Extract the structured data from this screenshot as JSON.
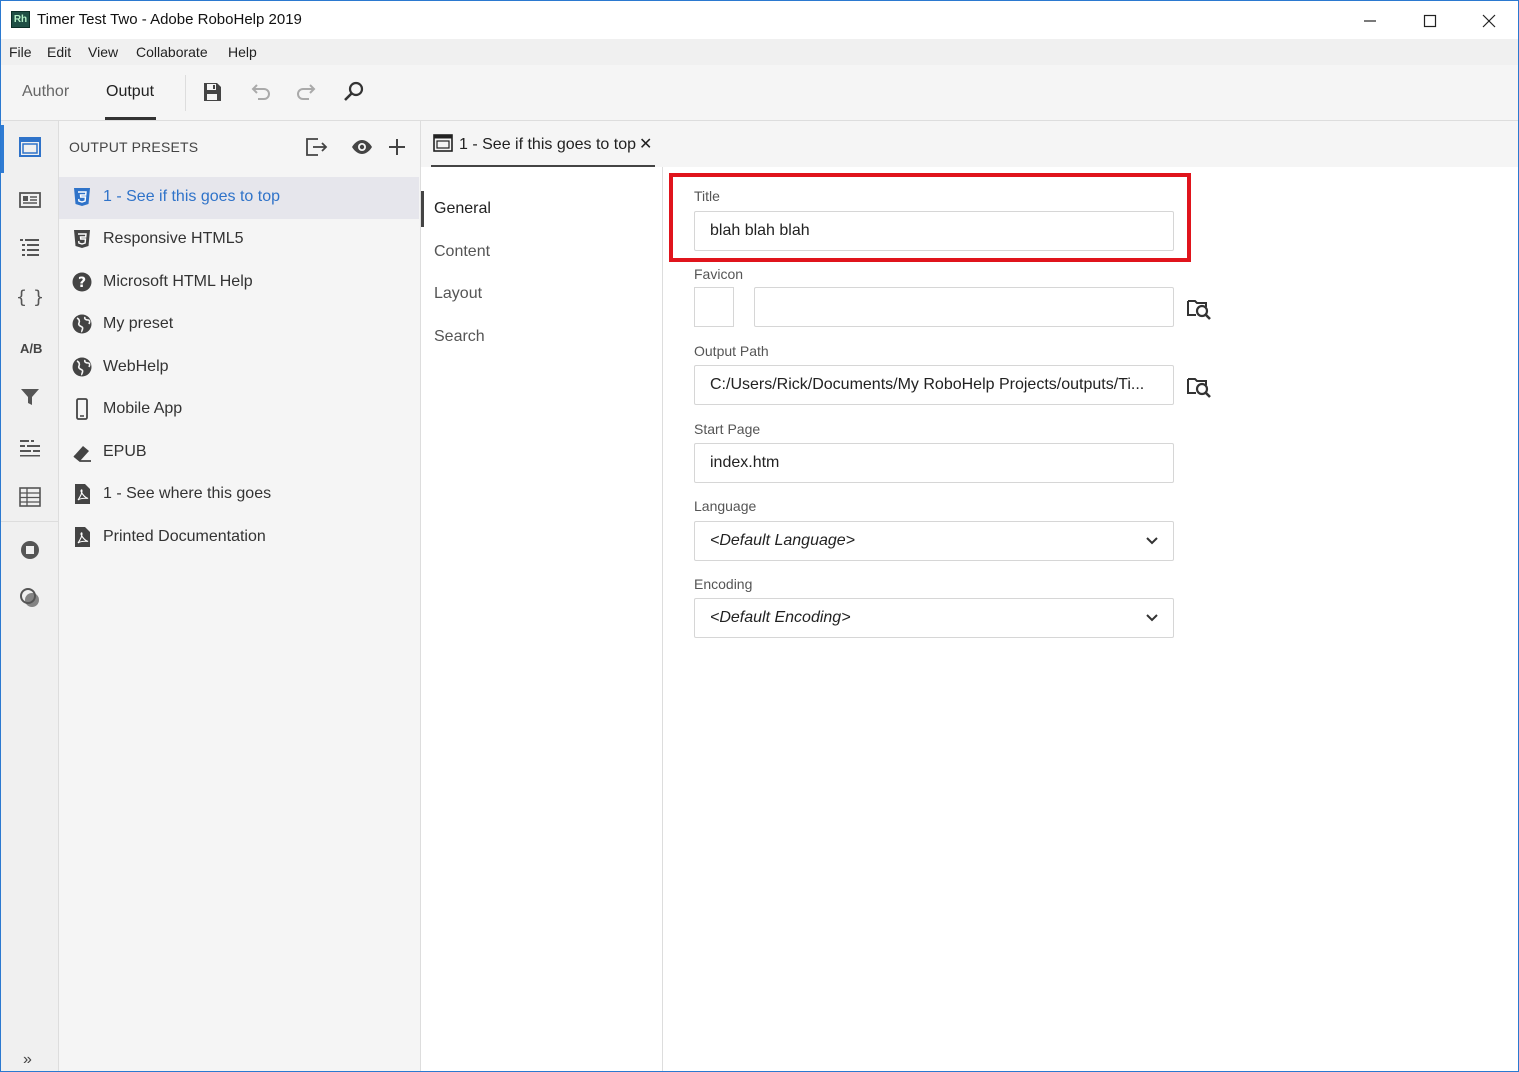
{
  "window": {
    "title": "Timer Test Two - Adobe RoboHelp 2019",
    "logo_text": "Rh",
    "minimize": "—",
    "maximize": "☐",
    "close": "✕"
  },
  "menu": [
    "File",
    "Edit",
    "View",
    "Collaborate",
    "Help"
  ],
  "toolbar": {
    "modes": [
      "Author",
      "Output"
    ],
    "active_mode": "Output",
    "icons": [
      "save-icon",
      "undo-icon",
      "redo-icon",
      "search-icon"
    ]
  },
  "rail": {
    "ab_label": "A/B",
    "expand_label": "»"
  },
  "presets_panel": {
    "header": "OUTPUT PRESETS",
    "items": [
      {
        "label": "1 - See if this goes to top",
        "icon": "html5-icon",
        "selected": true
      },
      {
        "label": "Responsive HTML5",
        "icon": "html5-icon"
      },
      {
        "label": "Microsoft HTML Help",
        "icon": "help-icon"
      },
      {
        "label": "My preset",
        "icon": "globe-icon"
      },
      {
        "label": "WebHelp",
        "icon": "globe-icon"
      },
      {
        "label": "Mobile App",
        "icon": "mobile-icon"
      },
      {
        "label": "EPUB",
        "icon": "epub-icon"
      },
      {
        "label": "1 - See where this goes",
        "icon": "pdf-icon"
      },
      {
        "label": "Printed Documentation",
        "icon": "pdf-icon"
      }
    ]
  },
  "doc_tab": {
    "label": "1 - See if this goes to top",
    "close": "✕"
  },
  "settings_nav": [
    "General",
    "Content",
    "Layout",
    "Search"
  ],
  "form": {
    "title_label": "Title",
    "title_value": "blah blah blah",
    "favicon_label": "Favicon",
    "favicon_value": "",
    "output_path_label": "Output Path",
    "output_path_value": "C:/Users/Rick/Documents/My RoboHelp Projects/outputs/Ti...",
    "start_page_label": "Start Page",
    "start_page_value": "index.htm",
    "language_label": "Language",
    "language_value": "<Default Language>",
    "encoding_label": "Encoding",
    "encoding_value": "<Default Encoding>"
  },
  "colors": {
    "accent": "#2f73c9",
    "highlight": "#e0141c"
  }
}
